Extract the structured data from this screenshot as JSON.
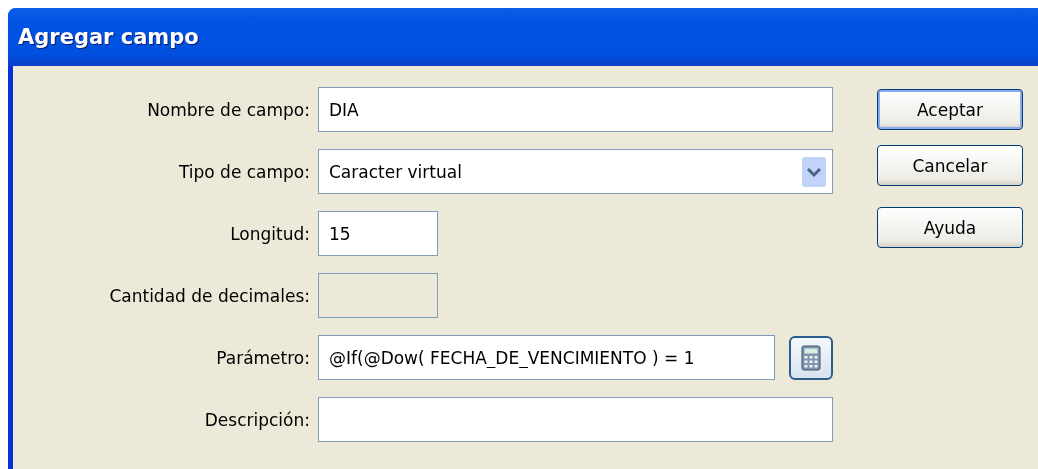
{
  "window": {
    "title": "Agregar campo"
  },
  "fields": [
    {
      "label": "Nombre de campo:",
      "kind": "text",
      "value": "DIA"
    },
    {
      "label": "Tipo de campo:",
      "kind": "select",
      "value": "Caracter virtual"
    },
    {
      "label": "Longitud:",
      "kind": "number",
      "value": "15"
    },
    {
      "label": "Cantidad de decimales:",
      "kind": "number",
      "disabled": true
    },
    {
      "label": "Parámetro:",
      "kind": "formula",
      "value": "@If(@Dow( FECHA_DE_VENCIMIENTO ) = 1"
    },
    {
      "label": "Descripción:",
      "kind": "text"
    }
  ],
  "buttons": [
    {
      "label": "Aceptar",
      "default": true
    },
    {
      "label": "Cancelar",
      "default": false
    },
    {
      "label": "Ayuda",
      "default": false
    }
  ]
}
